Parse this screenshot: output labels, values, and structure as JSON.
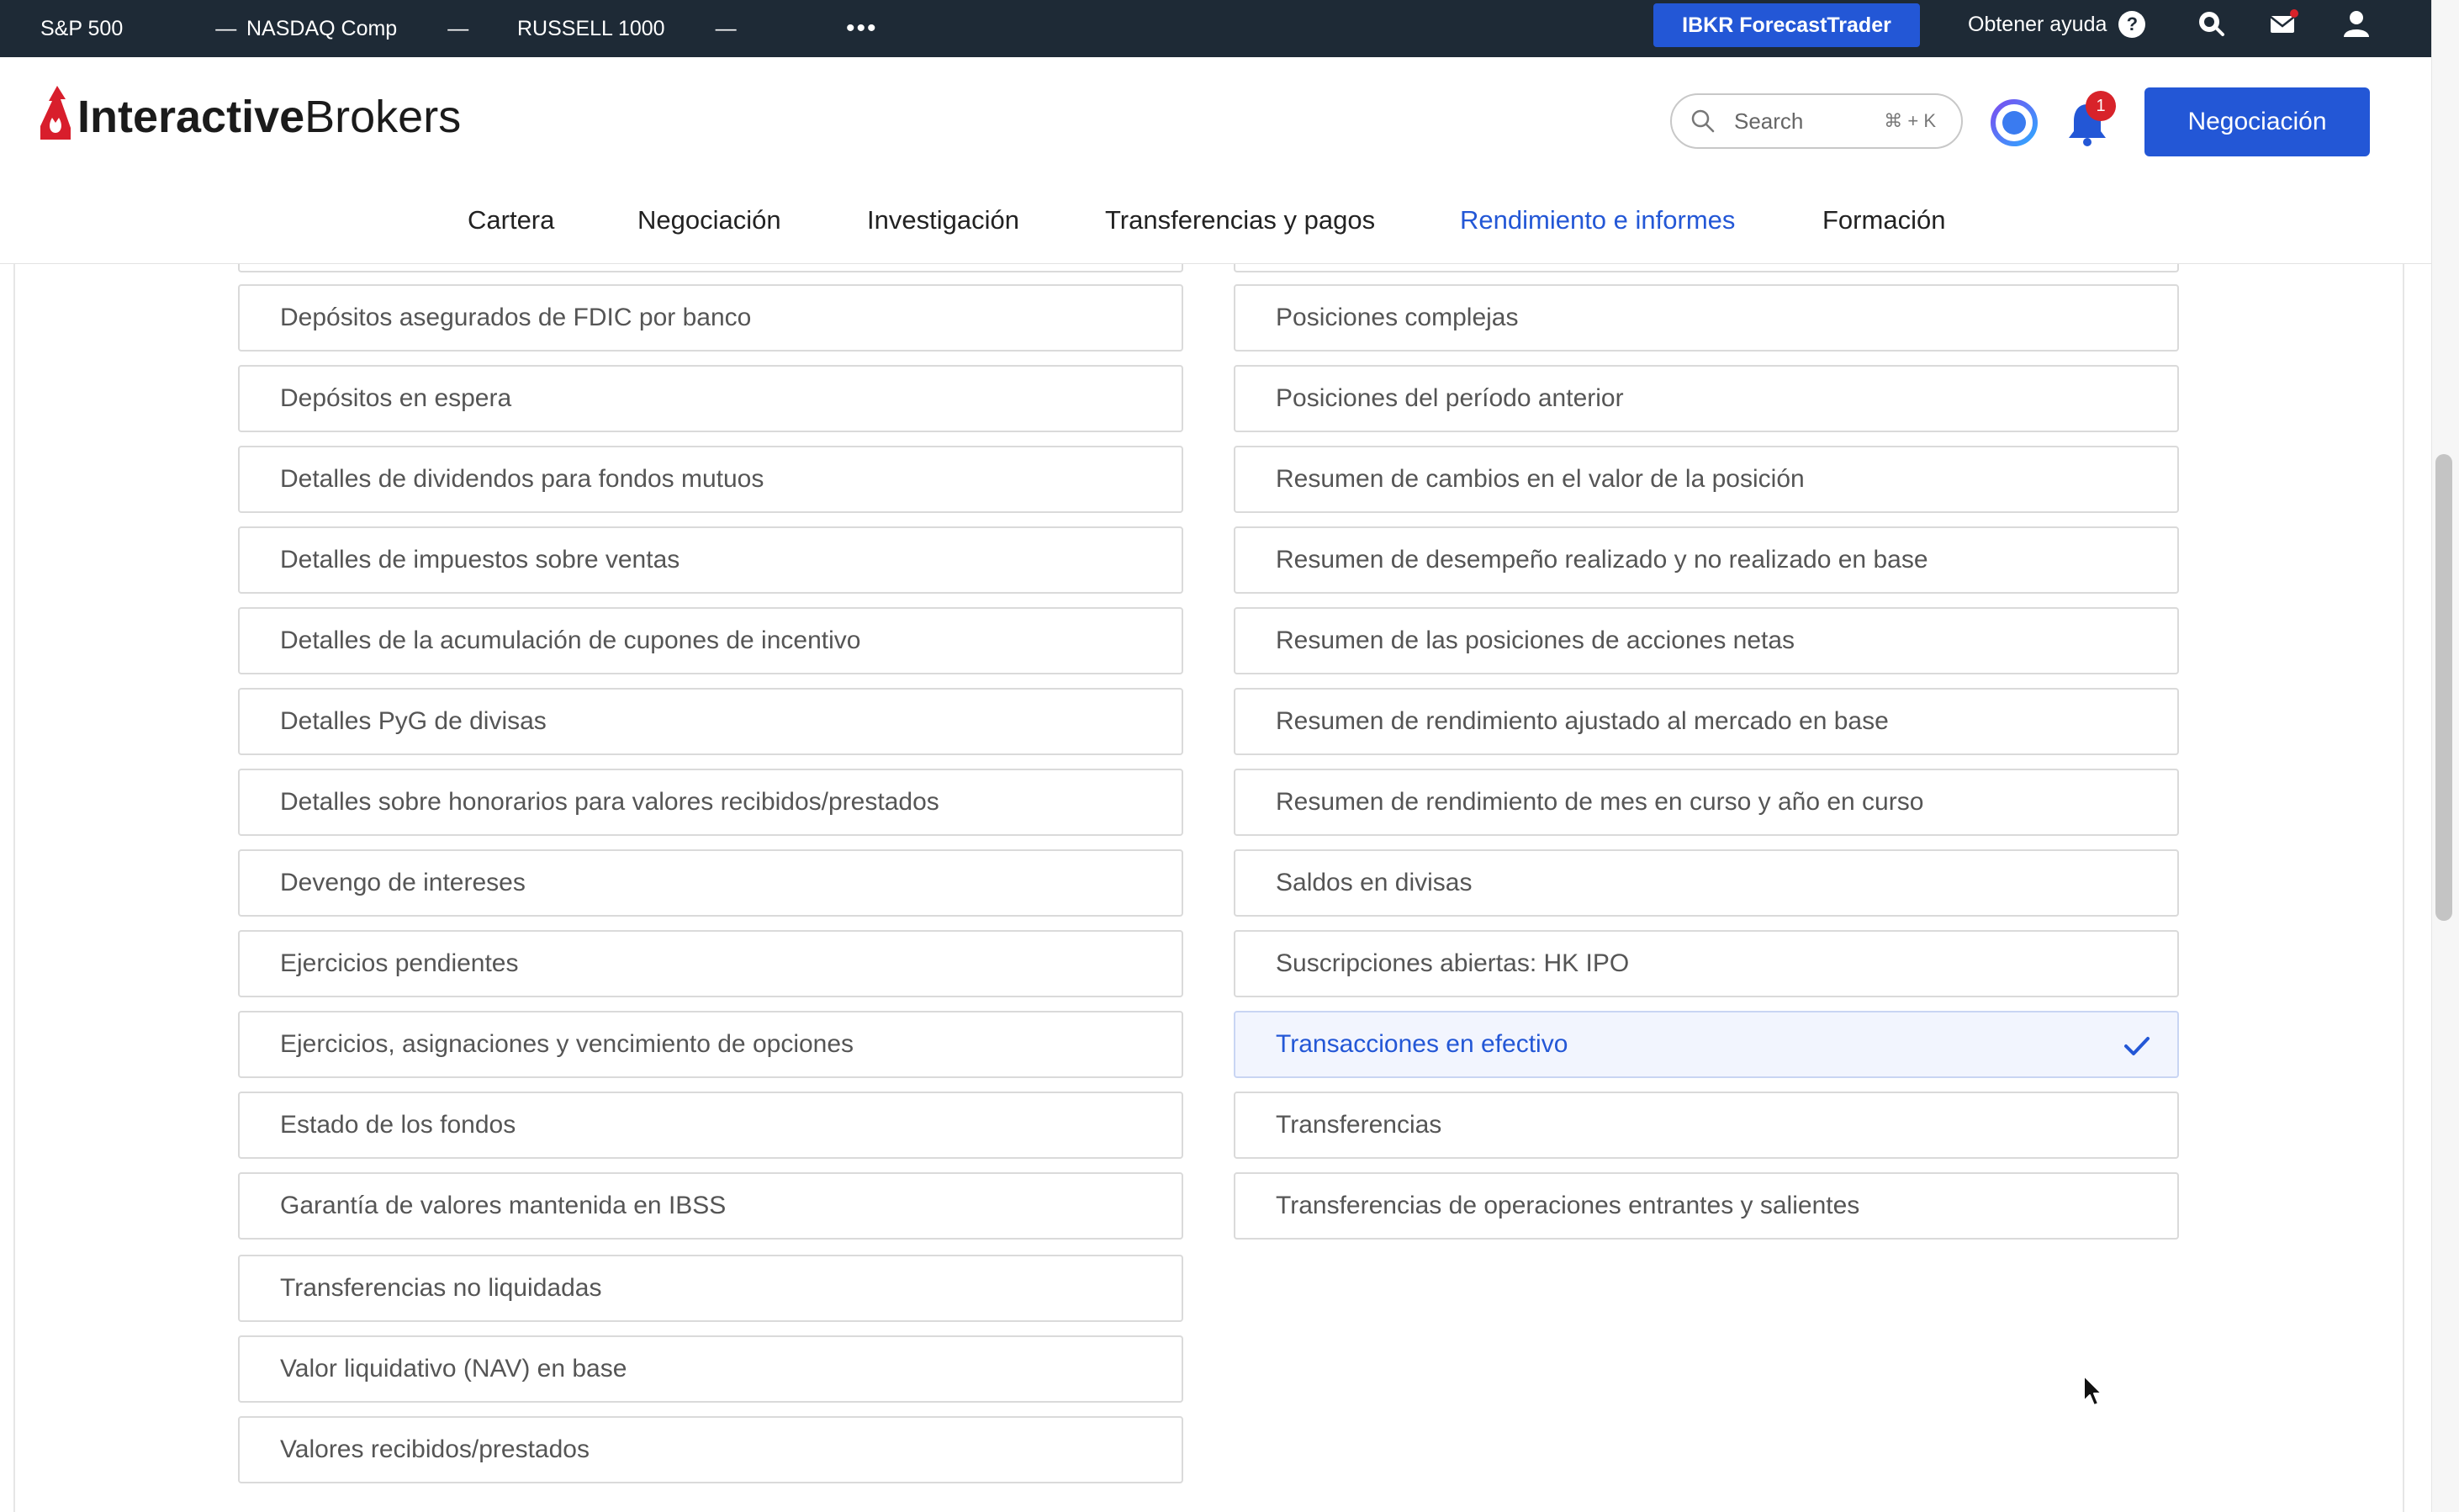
{
  "ticker": {
    "items": [
      {
        "name": "S&P 500",
        "value": "—"
      },
      {
        "name": "NASDAQ Comp",
        "value": "—"
      },
      {
        "name": "RUSSELL 1000",
        "value": "—"
      }
    ],
    "more": "•••",
    "forecast_button": "IBKR ForecastTrader",
    "help_label": "Obtener ayuda",
    "help_icon": "?"
  },
  "header": {
    "logo_bold": "Interactive",
    "logo_regular": "Brokers",
    "search_placeholder": "Search",
    "search_shortcut": "⌘ + K",
    "notification_count": "1",
    "trade_button": "Negociación",
    "nav": [
      "Cartera",
      "Negociación",
      "Investigación",
      "Transferencias y pagos",
      "Rendimiento e informes",
      "Formación"
    ],
    "active_nav": "Rendimiento e informes"
  },
  "reports": {
    "left_column": [
      "Depósitos asegurados de FDIC por banco",
      "Depósitos en espera",
      "Detalles de dividendos para fondos mutuos",
      "Detalles de impuestos sobre ventas",
      "Detalles de la acumulación de cupones de incentivo",
      "Detalles PyG de divisas",
      "Detalles sobre honorarios para valores recibidos/prestados",
      "Devengo de intereses",
      "Ejercicios pendientes",
      "Ejercicios, asignaciones y vencimiento de opciones",
      "Estado de los fondos",
      "Garantía de valores mantenida en IBSS",
      "Transferencias no liquidadas",
      "Valor liquidativo (NAV) en base",
      "Valores recibidos/prestados"
    ],
    "right_column": [
      "Posiciones complejas",
      "Posiciones del período anterior",
      "Resumen de cambios en el valor de la posición",
      "Resumen de desempeño realizado y no realizado en base",
      "Resumen de las posiciones de acciones netas",
      "Resumen de rendimiento ajustado al mercado en base",
      "Resumen de rendimiento de mes en curso y año en curso",
      "Saldos en divisas",
      "Suscripciones abiertas: HK IPO",
      "Transacciones en efectivo",
      "Transferencias",
      "Transferencias de operaciones entrantes y salientes"
    ],
    "selected": "Transacciones en efectivo"
  },
  "colors": {
    "accent": "#2357d6",
    "ticker_bg": "#1e2a36",
    "badge": "#d8232a",
    "logo_red": "#d81e2c"
  }
}
